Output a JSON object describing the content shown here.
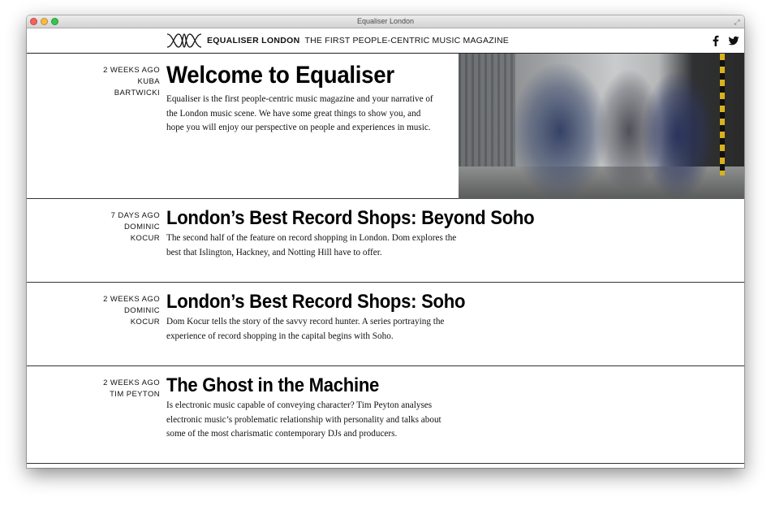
{
  "window": {
    "title": "Equaliser London"
  },
  "header": {
    "brand_name": "EQUALISER LONDON",
    "tagline": "THE FIRST PEOPLE-CENTRIC MUSIC MAGAZINE",
    "social": [
      "facebook-icon",
      "twitter-icon"
    ]
  },
  "articles": [
    {
      "age": "2 WEEKS AGO",
      "author": "KUBA BARTWICKI",
      "title": "Welcome to Equaliser",
      "excerpt": "Equaliser is the first people-centric music magazine and your narrative of the London music scene. We have some great things to show you, and hope you will enjoy our perspective on people and experiences in music."
    },
    {
      "age": "7 DAYS AGO",
      "author": "DOMINIC KOCUR",
      "title": "London’s Best Record Shops: Beyond Soho",
      "excerpt": "The second half of the feature on record shopping in London. Dom explores the best that Islington, Hackney, and Notting Hill have to offer."
    },
    {
      "age": "2 WEEKS AGO",
      "author": "DOMINIC KOCUR",
      "title": "London’s Best Record Shops: Soho",
      "excerpt": "Dom Kocur tells the story of the savvy record hunter. A series portraying the experience of record shopping in the capital begins with Soho."
    },
    {
      "age": "2 WEEKS AGO",
      "author": "TIM PEYTON",
      "title": "The Ghost in the Machine",
      "excerpt": "Is electronic music capable of conveying character? Tim Peyton analyses electronic music’s problematic relationship with personality and talks about some of the most charismatic contemporary DJs and producers."
    }
  ]
}
